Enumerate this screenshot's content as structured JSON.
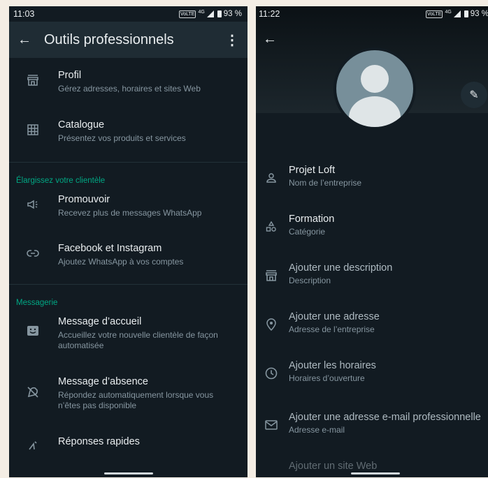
{
  "left": {
    "status": {
      "time": "11:03",
      "volte": "VoLTE",
      "network": "4G",
      "battery": "93 %"
    },
    "appbar": {
      "title": "Outils professionnels"
    },
    "group1": [
      {
        "title": "Profil",
        "subtitle": "Gérez adresses, horaires et sites Web",
        "icon": "storefront-icon"
      },
      {
        "title": "Catalogue",
        "subtitle": "Présentez vos produits et services",
        "icon": "grid-icon"
      }
    ],
    "section1": "Élargissez votre clientèle",
    "group2": [
      {
        "title": "Promouvoir",
        "subtitle": "Recevez plus de messages WhatsApp",
        "icon": "megaphone-icon"
      },
      {
        "title": "Facebook et Instagram",
        "subtitle": "Ajoutez WhatsApp à vos comptes",
        "icon": "link-icon"
      }
    ],
    "section2": "Messagerie",
    "group3": [
      {
        "title": "Message d’accueil",
        "subtitle": "Accueillez votre nouvelle clientèle de façon automatisée",
        "icon": "smile-message-icon"
      },
      {
        "title": "Message d’absence",
        "subtitle": "Répondez automatiquement lorsque vous n’êtes pas disponible",
        "icon": "away-icon"
      },
      {
        "title": "Réponses rapides",
        "subtitle": "",
        "icon": "quick-reply-icon"
      }
    ]
  },
  "right": {
    "status": {
      "time": "11:22",
      "volte": "VoLTE",
      "network": "4G",
      "battery": "93 %"
    },
    "items": [
      {
        "title": "Projet Loft",
        "subtitle": "Nom de l’entreprise",
        "icon": "person-icon"
      },
      {
        "title": "Formation",
        "subtitle": "Catégorie",
        "icon": "category-icon"
      },
      {
        "title": "Ajouter une description",
        "subtitle": "Description",
        "icon": "storefront-icon"
      },
      {
        "title": "Ajouter une adresse",
        "subtitle": "Adresse de l’entreprise",
        "icon": "location-icon"
      },
      {
        "title": "Ajouter les horaires",
        "subtitle": "Horaires d’ouverture",
        "icon": "clock-icon"
      },
      {
        "title": "Ajouter une adresse e-mail professionnelle",
        "subtitle": "Adresse e-mail",
        "icon": "mail-icon"
      },
      {
        "title": "Ajouter un site Web",
        "subtitle": "",
        "icon": "globe-icon"
      }
    ]
  },
  "colors": {
    "background": "#121b22",
    "appbar": "#1f2c34",
    "accent": "#00a884",
    "secondary_text": "#8696a0"
  }
}
